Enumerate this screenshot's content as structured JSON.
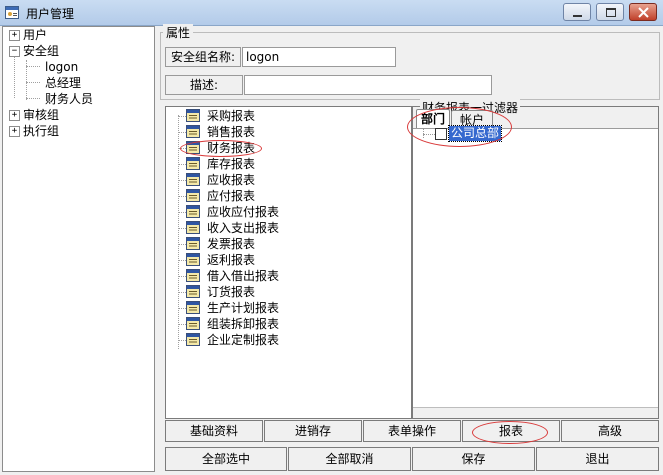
{
  "window": {
    "title": "用户管理"
  },
  "left_tree": {
    "items": [
      {
        "label": "用户",
        "expander": "+"
      },
      {
        "label": "安全组",
        "expander": "−"
      },
      {
        "label": "logon"
      },
      {
        "label": "总经理"
      },
      {
        "label": "财务人员"
      },
      {
        "label": "审核组",
        "expander": "+"
      },
      {
        "label": "执行组",
        "expander": "+"
      }
    ]
  },
  "properties": {
    "title": "属性",
    "group_name_label": "安全组名称:",
    "group_name_value": "logon",
    "description_label": "描述:",
    "description_value": ""
  },
  "reports": {
    "items": [
      "采购报表",
      "销售报表",
      "财务报表",
      "库存报表",
      "应收报表",
      "应付报表",
      "应收应付报表",
      "收入支出报表",
      "发票报表",
      "返利报表",
      "借入借出报表",
      "订货报表",
      "生产计划报表",
      "组装拆卸报表",
      "企业定制报表"
    ]
  },
  "filter": {
    "title": "财务报表一过滤器",
    "tabs": [
      "部门",
      "帐户"
    ],
    "active_tab": "部门",
    "nodes": [
      {
        "label": "公司总部",
        "checked": false
      }
    ]
  },
  "category_buttons": [
    "基础资料",
    "进销存",
    "表单操作",
    "报表",
    "高级"
  ],
  "action_buttons": [
    "全部选中",
    "全部取消",
    "保存",
    "退出"
  ],
  "colors": {
    "highlight": "#3569cf",
    "annotation": "#d93b3b"
  }
}
